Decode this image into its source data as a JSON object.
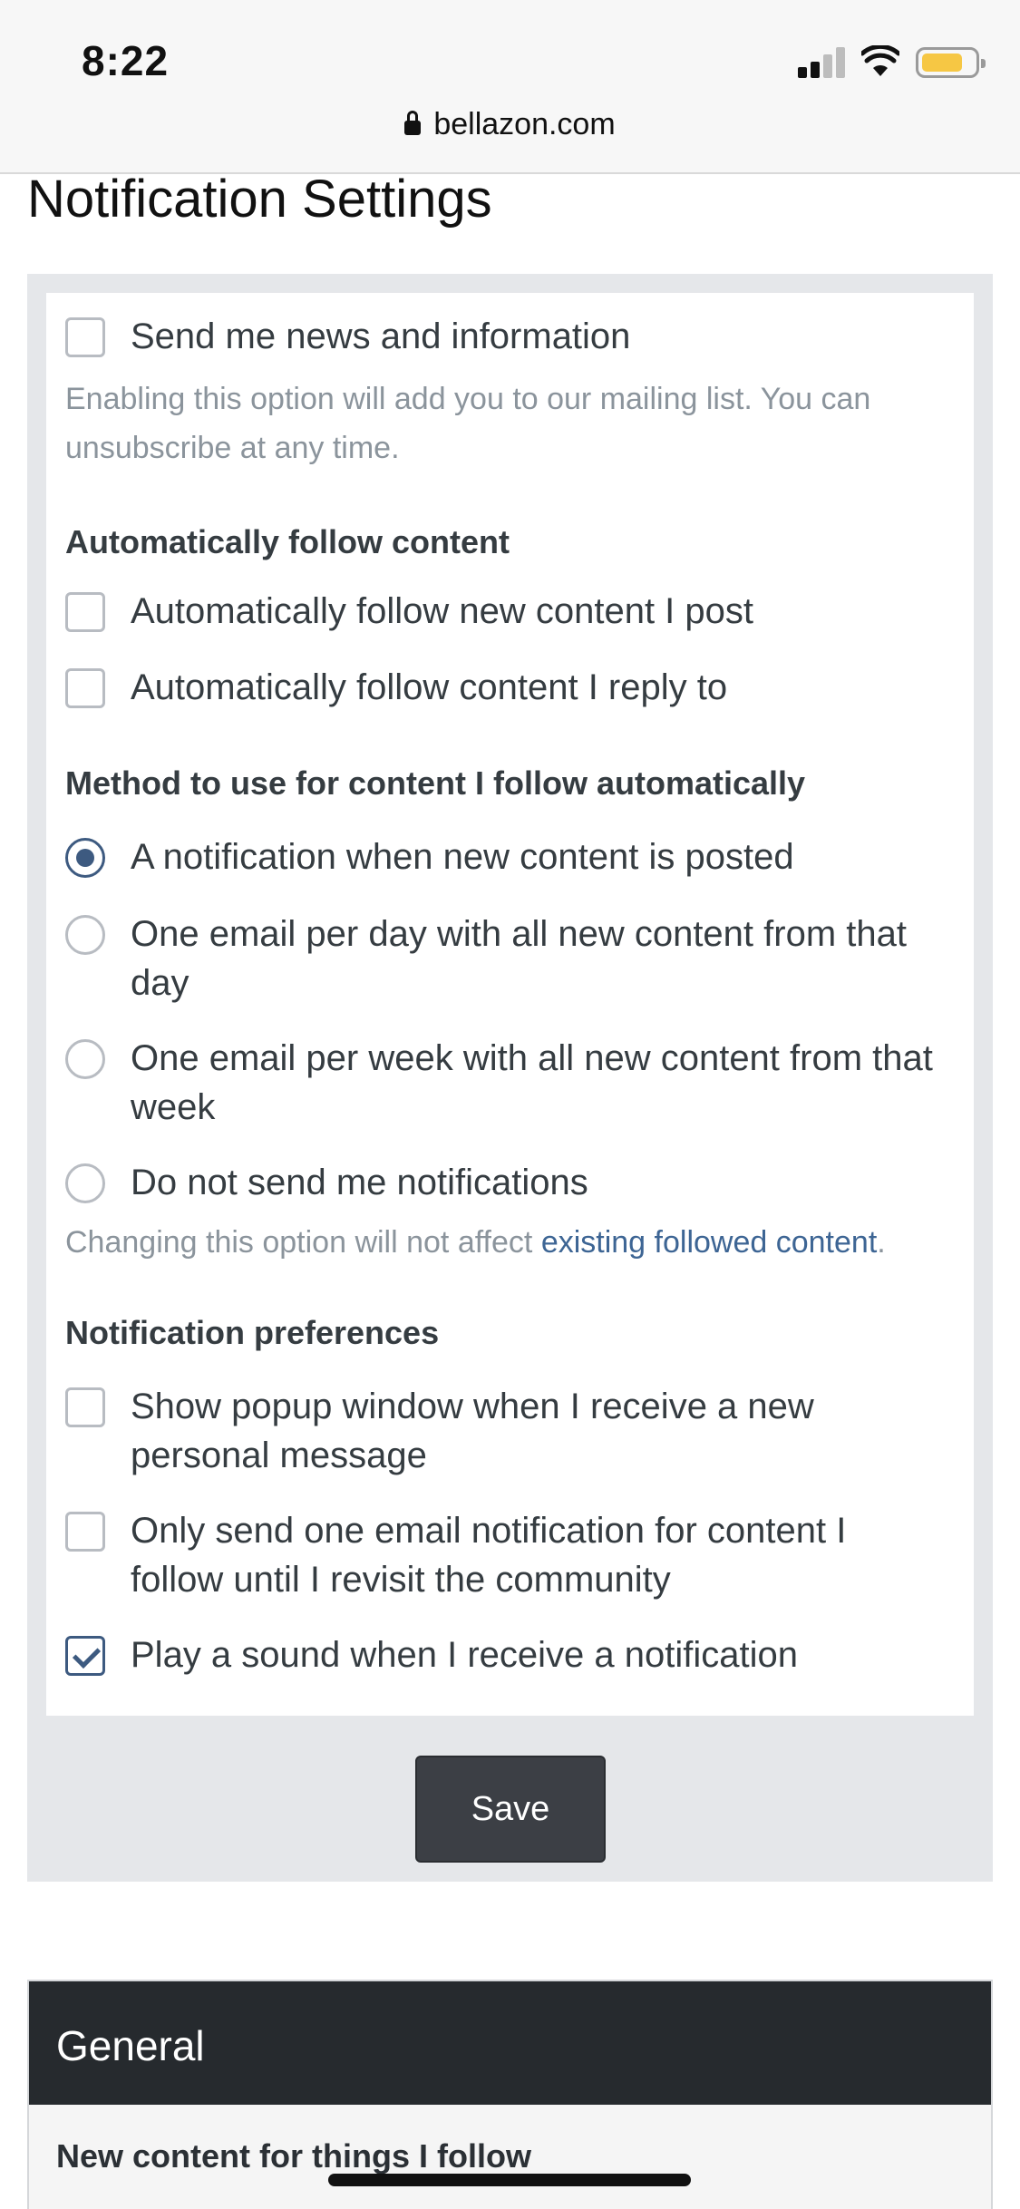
{
  "status_bar": {
    "time": "8:22",
    "icons": [
      "cellular-signal-icon",
      "wifi-icon",
      "battery-icon"
    ],
    "battery_color": "#f6c744"
  },
  "url_bar": {
    "domain": "bellazon.com",
    "icon": "lock-icon"
  },
  "page_title": "Notification Settings",
  "news": {
    "label": "Send me news and information",
    "checked": false,
    "help": "Enabling this option will add you to our mailing list. You can unsubscribe at any time."
  },
  "auto_follow": {
    "heading": "Automatically follow content",
    "options": [
      {
        "label": "Automatically follow new content I post",
        "checked": false
      },
      {
        "label": "Automatically follow content I reply to",
        "checked": false
      }
    ]
  },
  "method": {
    "heading": "Method to use for content I follow automatically",
    "options": [
      {
        "label": "A notification when new content is posted",
        "selected": true
      },
      {
        "label": "One email per day with all new content from that day",
        "selected": false
      },
      {
        "label": "One email per week with all new content from that week",
        "selected": false
      },
      {
        "label": "Do not send me notifications",
        "selected": false
      }
    ],
    "help_prefix": "Changing this option will not affect ",
    "help_link": "existing followed content",
    "help_suffix": "."
  },
  "preferences": {
    "heading": "Notification preferences",
    "options": [
      {
        "label": "Show popup window when I receive a new personal message",
        "checked": false
      },
      {
        "label": "Only send one email notification for content I follow until I revisit the community",
        "checked": false
      },
      {
        "label": "Play a sound when I receive a notification",
        "checked": true
      }
    ]
  },
  "save_button": "Save",
  "general": {
    "title": "General",
    "subtitle": "New content for things I follow"
  },
  "colors": {
    "accent": "#3d5a80",
    "link": "#3d6594",
    "panel_bg": "#e5e7ea",
    "header_dark": "#262a2e",
    "button_dark": "#3c3f45"
  }
}
